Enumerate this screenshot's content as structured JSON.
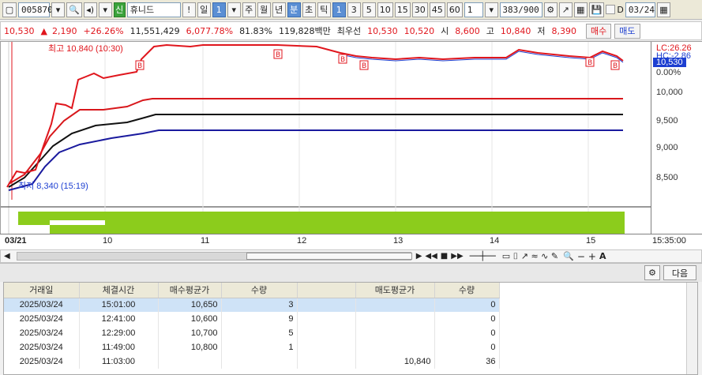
{
  "toolbar": {
    "stock_code": "005870",
    "name_badge": "신",
    "stock_name": "휴니드",
    "exclaim": "!",
    "period_day": "일",
    "period_num": "1",
    "periods": [
      "주",
      "월",
      "년",
      "분",
      "초",
      "틱"
    ],
    "intervals": [
      "1",
      "3",
      "5",
      "10",
      "15",
      "30",
      "45",
      "60"
    ],
    "count_value": "1",
    "data_count": "383/900",
    "date_value": "03/24",
    "date_prefix": "D"
  },
  "quote": {
    "price": "10,530",
    "arrow": "▲",
    "change": "2,190",
    "change_rate": "+26.26%",
    "volume": "11,551,429",
    "vol_rate": "6,077.78%",
    "turnover": "81.83%",
    "amount": "119,828백만",
    "best_label": "최우선",
    "best_ask": "10,530",
    "best_bid": "10,520",
    "open_label": "시",
    "open": "8,600",
    "high_label": "고",
    "high": "10,840",
    "low_label": "저",
    "low": "8,390",
    "buy_label": "매수",
    "sell_label": "매도"
  },
  "chart": {
    "high_annot": "최고 10,840 (10:30)",
    "low_annot": "최저 8,340 (15:19)",
    "lc_label": "LC:26.26",
    "hc_label": "HC:-2.86",
    "price_box": "10,530",
    "pct_label": "0.00%",
    "y_ticks": [
      "10,000",
      "9,500",
      "9,000",
      "8,500"
    ],
    "x_labels": [
      "03/21",
      "10",
      "11",
      "12",
      "13",
      "14",
      "15",
      "15:35:00"
    ],
    "signal_label": "B",
    "colors": {
      "up": "#e0161d",
      "down": "#1d3fd1",
      "volume": "#8ccc1c"
    }
  },
  "bottom": {
    "next_label": "다음",
    "columns": [
      "거래일",
      "체결시간",
      "매수평균가",
      "수량",
      "",
      "매도평균가",
      "수량"
    ],
    "rows": [
      [
        "2025/03/24",
        "15:01:00",
        "10,650",
        "3",
        "",
        "",
        "0"
      ],
      [
        "2025/03/24",
        "12:41:00",
        "10,600",
        "9",
        "",
        "",
        "0"
      ],
      [
        "2025/03/24",
        "12:29:00",
        "10,700",
        "5",
        "",
        "",
        "0"
      ],
      [
        "2025/03/24",
        "11:49:00",
        "10,800",
        "1",
        "",
        "",
        "0"
      ],
      [
        "2025/03/24",
        "11:03:00",
        "",
        "",
        "",
        "10,840",
        "36"
      ]
    ]
  }
}
